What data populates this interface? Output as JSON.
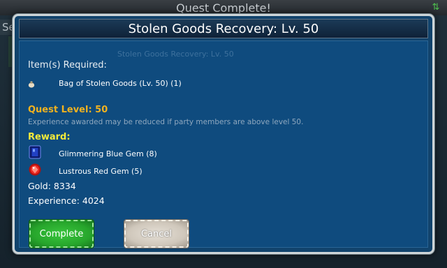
{
  "background": {
    "title": "Quest Complete!",
    "tab_label": "Se",
    "ghost_text": "Stolen Goods Recovery: Lv. 50",
    "sort_icon": "sort-arrows-icon"
  },
  "dialog": {
    "title": "Stolen Goods Recovery: Lv. 50",
    "required_heading": "Item(s) Required:",
    "required_items": [
      {
        "icon": "bag-icon",
        "label": "Bag of Stolen Goods (Lv. 50) (1)"
      }
    ],
    "quest_level": "Quest Level: 50",
    "xp_note": "Experience awarded may be reduced if party members are above level 50.",
    "reward_heading": "Reward:",
    "rewards": [
      {
        "icon": "blue-gem-icon",
        "label": "Glimmering Blue Gem (8)",
        "color": "#1c2f9b"
      },
      {
        "icon": "red-gem-icon",
        "label": "Lustrous Red Gem (5)",
        "color": "#e2231f"
      }
    ],
    "gold": "Gold: 8334",
    "experience": "Experience: 4024",
    "buttons": {
      "complete": "Complete",
      "cancel": "Cancel"
    }
  },
  "colors": {
    "dialog_bg": "#0f4b7e",
    "quest_level": "#f1b21f",
    "reward": "#f4ea3a",
    "complete_button": "#2aa72e",
    "cancel_button": "#d6cfc4"
  }
}
